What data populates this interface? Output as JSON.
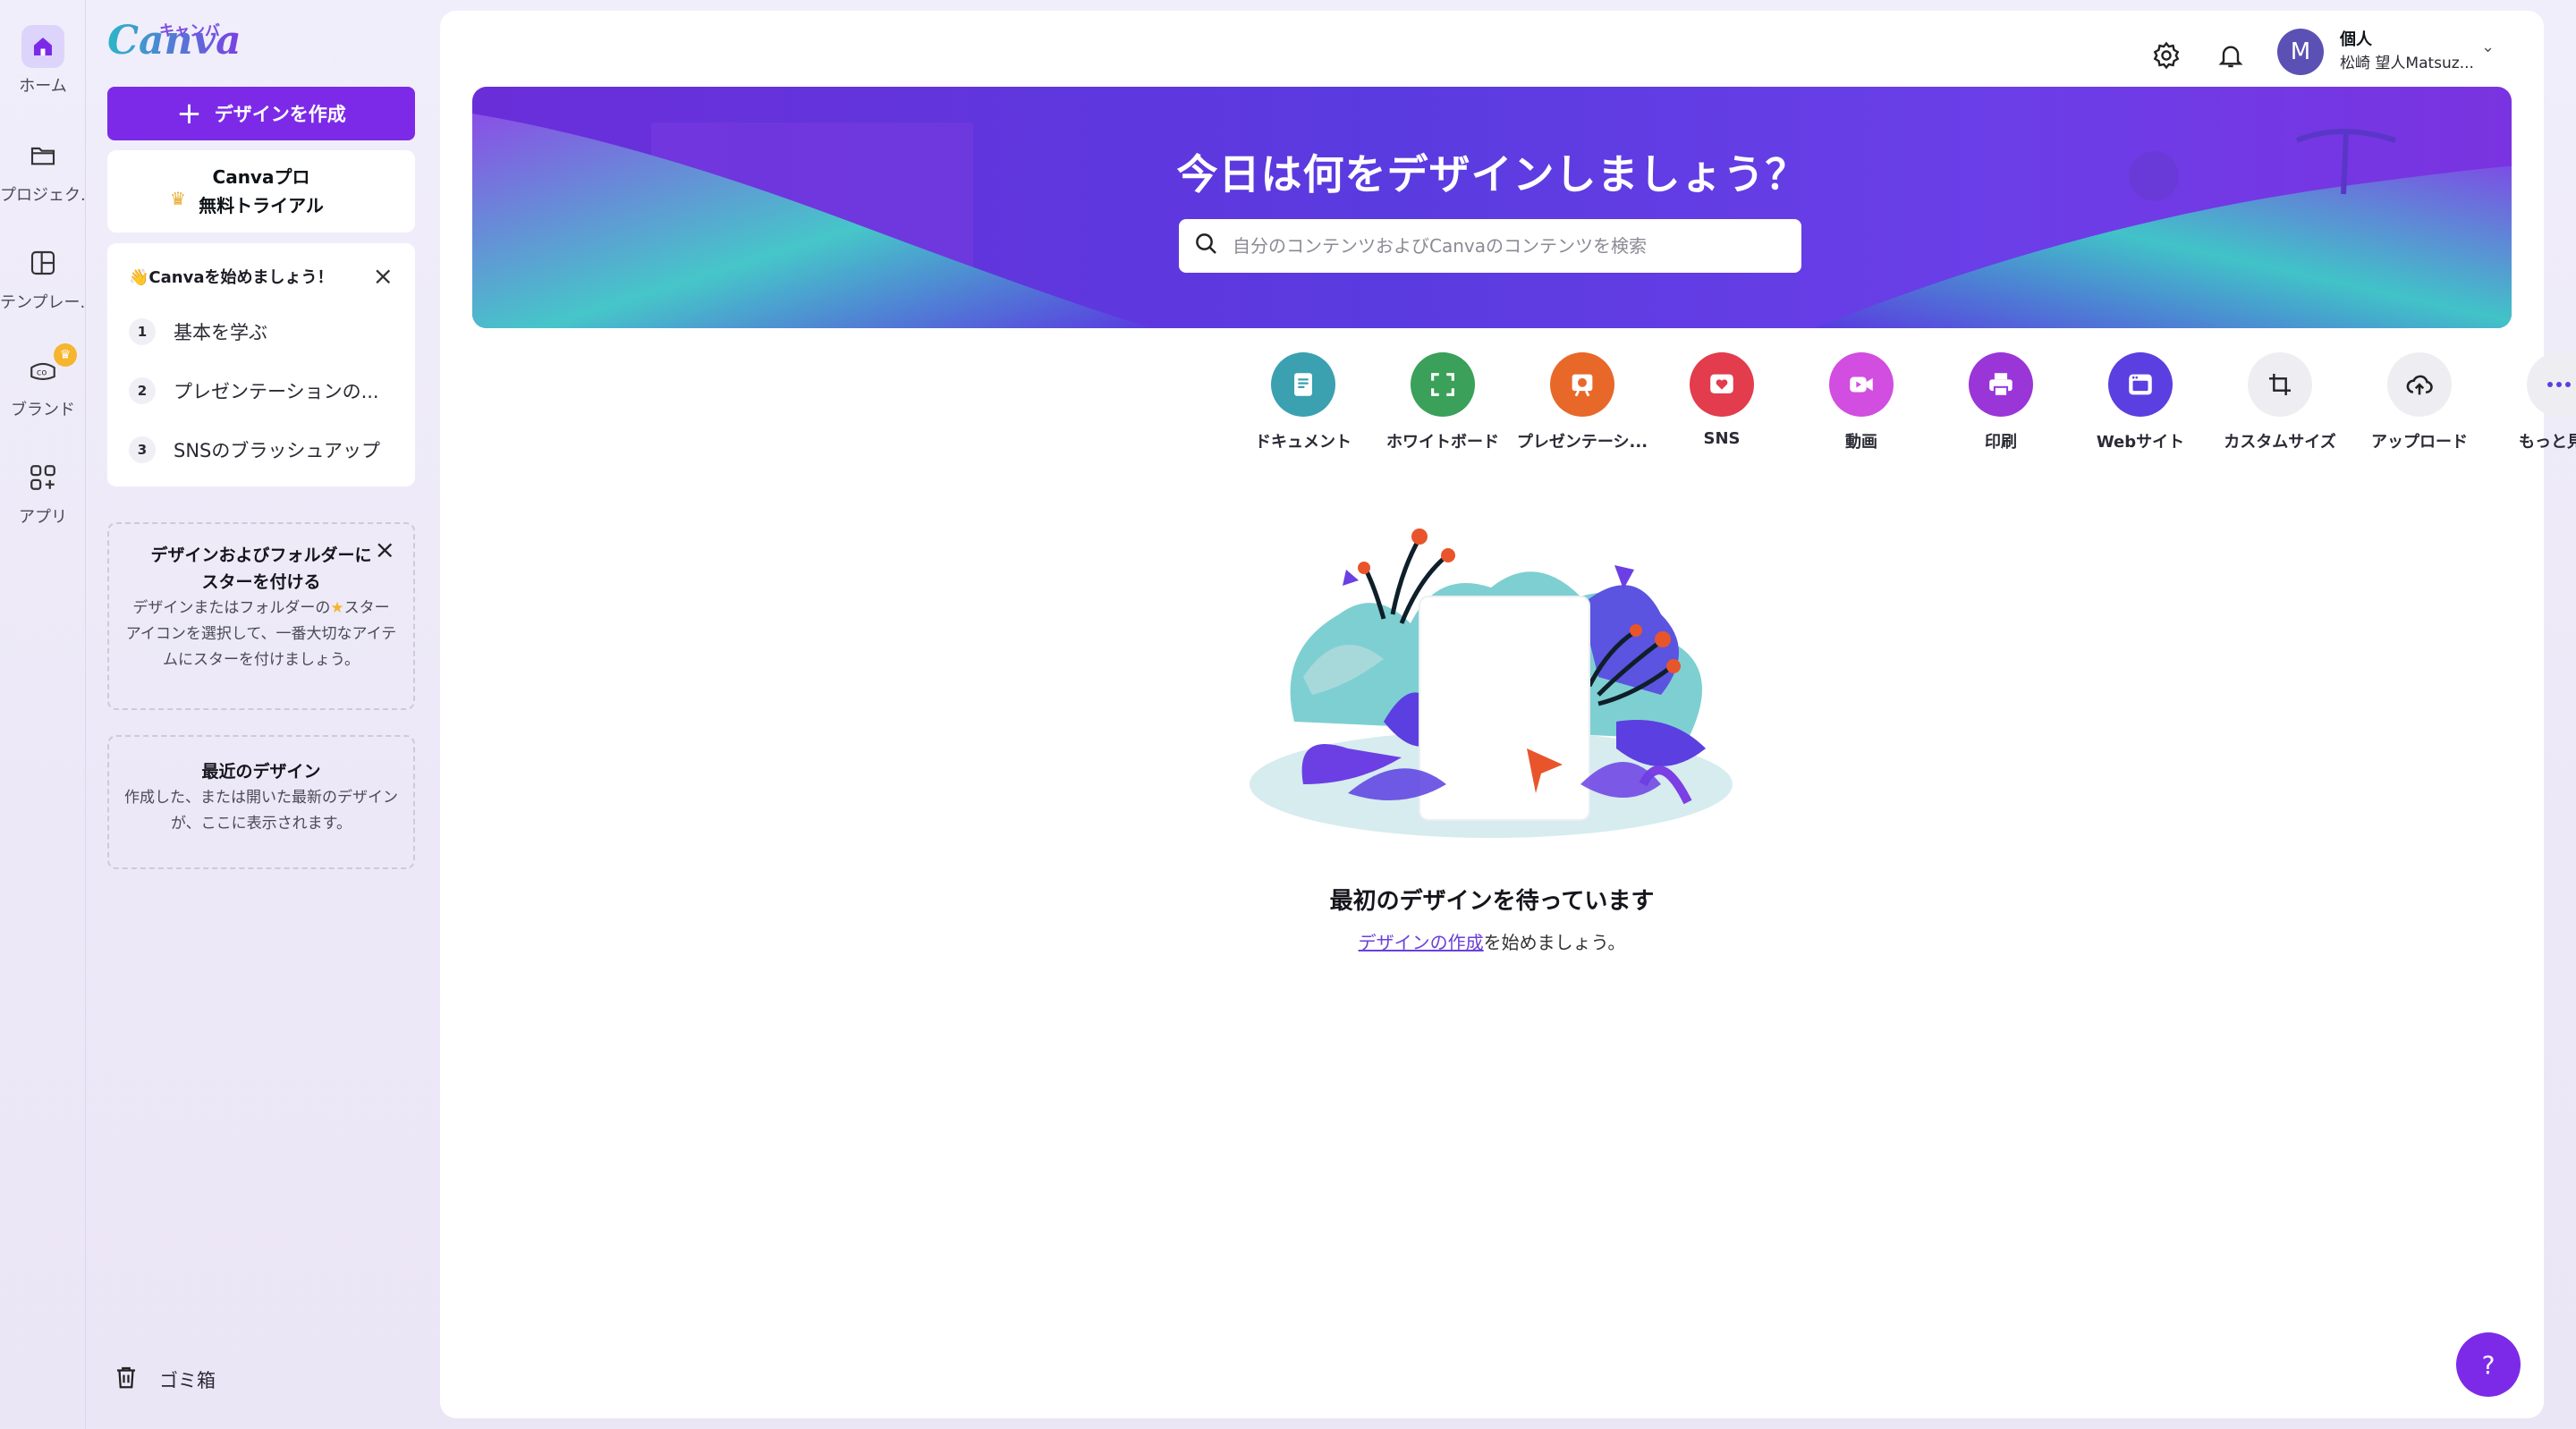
{
  "rail": {
    "items": [
      {
        "label": "ホーム"
      },
      {
        "label": "プロジェク..."
      },
      {
        "label": "テンプレー..."
      },
      {
        "label": "ブランド"
      },
      {
        "label": "アプリ"
      }
    ]
  },
  "panel": {
    "logo": "Canva",
    "logo_kana": "キャンバ",
    "create_button": "デザインを作成",
    "trial_line1": "Canvaプロ",
    "trial_line2": "無料トライアル",
    "start_title": "Canvaを始めましょう！",
    "steps": [
      {
        "num": "1",
        "label": "基本を学ぶ"
      },
      {
        "num": "2",
        "label": "プレゼンテーションの..."
      },
      {
        "num": "3",
        "label": "SNSのブラッシュアップ"
      }
    ],
    "star_card_title_1": "デザインおよびフォルダーに",
    "star_card_title_2": "スターを付ける",
    "star_card_body_1": "デザインまたはフォルダーの",
    "star_card_body_1b": "スター",
    "star_card_body_2": "アイコンを選択して、一番大切なアイテ",
    "star_card_body_3": "ムにスターを付けましょう。",
    "recent_title": "最近のデザイン",
    "recent_body_1": "作成した、または開いた最新のデザイン",
    "recent_body_2": "が、ここに表示されます。",
    "trash": "ゴミ箱"
  },
  "account": {
    "avatar_initial": "M",
    "type": "個人",
    "name": "松崎 望人Matsuz..."
  },
  "hero": {
    "title": "今日は何をデザインしましょう？",
    "search_placeholder": "自分のコンテンツおよびCanvaのコンテンツを検索"
  },
  "categories": [
    {
      "label": "ドキュメント",
      "color": "#3ba0b0",
      "icon": "document-icon"
    },
    {
      "label": "ホワイトボード",
      "color": "#3aa05a",
      "icon": "whiteboard-icon"
    },
    {
      "label": "プレゼンテーシ...",
      "color": "#e8682a",
      "icon": "presentation-icon"
    },
    {
      "label": "SNS",
      "color": "#e23c4d",
      "icon": "heart-icon"
    },
    {
      "label": "動画",
      "color": "#d14ee0",
      "icon": "video-icon"
    },
    {
      "label": "印刷",
      "color": "#9a35d8",
      "icon": "printer-icon"
    },
    {
      "label": "Webサイト",
      "color": "#5b3fe0",
      "icon": "website-icon"
    },
    {
      "label": "カスタムサイズ",
      "color": "#eeeef2",
      "icon": "crop-icon"
    },
    {
      "label": "アップロード",
      "color": "#eeeef2",
      "icon": "cloud-upload-icon"
    },
    {
      "label": "もっと見る",
      "color": "#eeeef2",
      "icon": "more-icon"
    }
  ],
  "empty": {
    "title": "最初のデザインを待っています",
    "link": "デザインの作成",
    "rest": "を始めましょう。"
  },
  "help": "?"
}
